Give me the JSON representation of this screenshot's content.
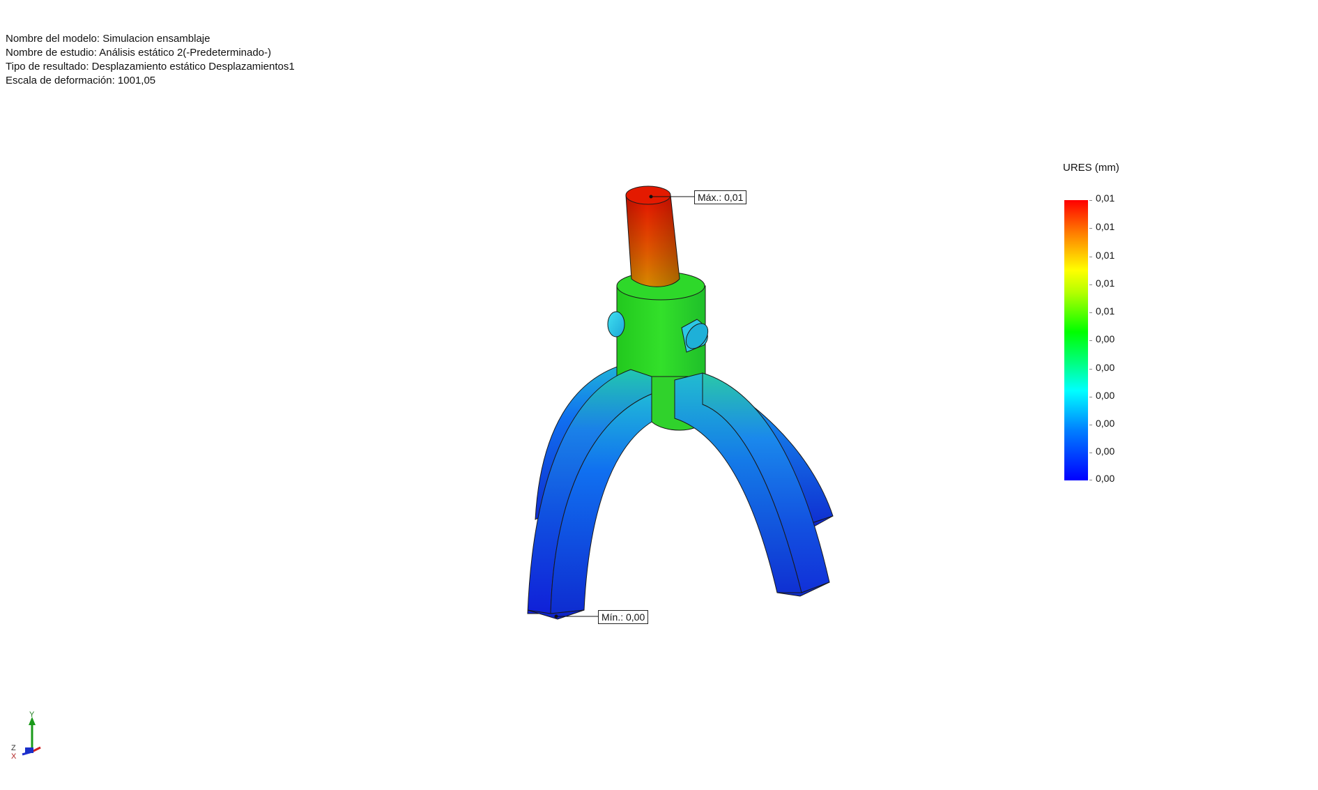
{
  "info": {
    "model_name": "Nombre del modelo: Simulacion ensamblaje",
    "study_name": "Nombre de estudio: Análisis estático 2(-Predeterminado-)",
    "result_type": "Tipo de resultado: Desplazamiento estático Desplazamientos1",
    "deformation_scale": "Escala de deformación: 1001,05"
  },
  "legend": {
    "title": "URES (mm)",
    "labels": [
      "0,01",
      "0,01",
      "0,01",
      "0,01",
      "0,01",
      "0,00",
      "0,00",
      "0,00",
      "0,00",
      "0,00",
      "0,00"
    ],
    "colors": [
      "#ff0000",
      "#ff8000",
      "#ffff00",
      "#00ff00",
      "#00ffff",
      "#0000ff"
    ]
  },
  "callouts": {
    "max": "Máx.: 0,01",
    "min": "Mín.: 0,00"
  },
  "triad": {
    "y": "Y",
    "z": "Z",
    "x": "X"
  }
}
